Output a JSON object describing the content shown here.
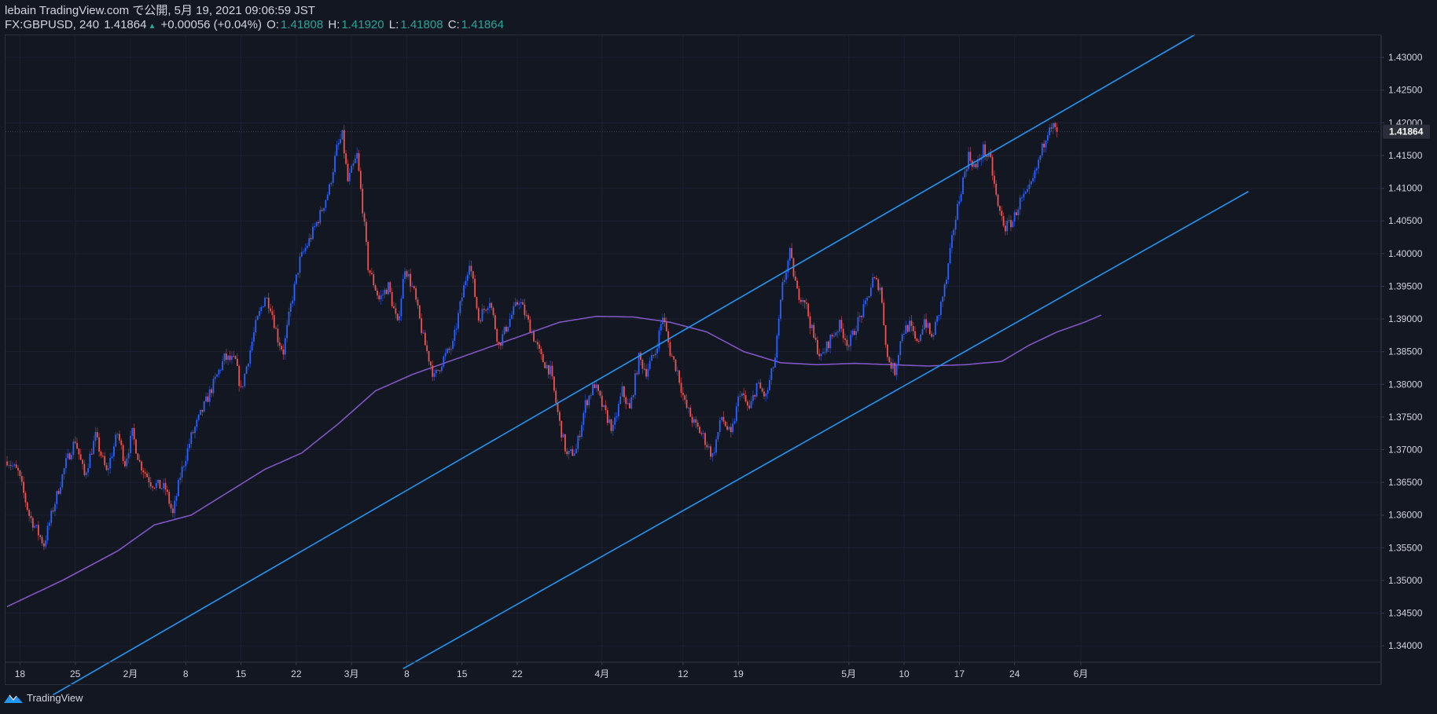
{
  "header": {
    "publish_line": "lebain TradingView.com で公開, 5月 19, 2021 09:06:59 JST",
    "symbol_interval": "FX:GBPUSD, 240",
    "last": "1.41864",
    "change": "+0.00056 (+0.04%)",
    "o_label": "O:",
    "o_value": "1.41808",
    "h_label": "H:",
    "h_value": "1.41920",
    "l_label": "L:",
    "l_value": "1.41808",
    "c_label": "C:",
    "c_value": "1.41864"
  },
  "footer": {
    "brand": "TradingView",
    "logo_icon": "tradingview-logo-icon"
  },
  "colors": {
    "background": "#131722",
    "up_candle": "#2962ff",
    "down_candle": "#ef5350",
    "moving_average": "#7e57c2",
    "channel": "#2196f3",
    "text": "#d1d4dc",
    "positive": "#26a69a"
  },
  "chart_data": {
    "type": "candlestick",
    "symbol": "FX:GBPUSD",
    "interval": "240",
    "y_ticks": [
      "1.43000",
      "1.42500",
      "1.42000",
      "1.41500",
      "1.41000",
      "1.40500",
      "1.40000",
      "1.39500",
      "1.39000",
      "1.38500",
      "1.38000",
      "1.37500",
      "1.37000",
      "1.36500",
      "1.36000",
      "1.35500",
      "1.35000",
      "1.34500",
      "1.34000"
    ],
    "ylim": [
      1.3375,
      1.4335
    ],
    "last_price_label": "1.41864",
    "x_ticks": [
      {
        "label": "18",
        "idx": 7
      },
      {
        "label": "25",
        "idx": 37
      },
      {
        "label": "2月",
        "idx": 67
      },
      {
        "label": "8",
        "idx": 97
      },
      {
        "label": "15",
        "idx": 127
      },
      {
        "label": "22",
        "idx": 157
      },
      {
        "label": "3月",
        "idx": 187
      },
      {
        "label": "8",
        "idx": 217
      },
      {
        "label": "15",
        "idx": 247
      },
      {
        "label": "22",
        "idx": 277
      },
      {
        "label": "4月",
        "idx": 323
      },
      {
        "label": "12",
        "idx": 367
      },
      {
        "label": "19",
        "idx": 397
      },
      {
        "label": "5月",
        "idx": 457
      },
      {
        "label": "10",
        "idx": 487
      },
      {
        "label": "17",
        "idx": 517
      },
      {
        "label": "24",
        "idx": 547
      },
      {
        "label": "6月",
        "idx": 583
      }
    ],
    "close_keypoints": [
      [
        0,
        1.3685
      ],
      [
        6,
        1.3665
      ],
      [
        12,
        1.36
      ],
      [
        20,
        1.3555
      ],
      [
        25,
        1.361
      ],
      [
        32,
        1.368
      ],
      [
        37,
        1.3715
      ],
      [
        42,
        1.366
      ],
      [
        48,
        1.372
      ],
      [
        54,
        1.3665
      ],
      [
        60,
        1.3725
      ],
      [
        64,
        1.368
      ],
      [
        68,
        1.3725
      ],
      [
        72,
        1.368
      ],
      [
        78,
        1.365
      ],
      [
        86,
        1.364
      ],
      [
        90,
        1.36
      ],
      [
        94,
        1.366
      ],
      [
        100,
        1.372
      ],
      [
        106,
        1.376
      ],
      [
        112,
        1.38
      ],
      [
        118,
        1.384
      ],
      [
        124,
        1.3835
      ],
      [
        127,
        1.379
      ],
      [
        131,
        1.384
      ],
      [
        135,
        1.389
      ],
      [
        140,
        1.3935
      ],
      [
        143,
        1.392
      ],
      [
        147,
        1.387
      ],
      [
        150,
        1.385
      ],
      [
        154,
        1.392
      ],
      [
        159,
        1.399
      ],
      [
        164,
        1.402
      ],
      [
        170,
        1.406
      ],
      [
        175,
        1.41
      ],
      [
        179,
        1.416
      ],
      [
        182,
        1.418
      ],
      [
        185,
        1.411
      ],
      [
        190,
        1.415
      ],
      [
        193,
        1.407
      ],
      [
        196,
        1.398
      ],
      [
        202,
        1.393
      ],
      [
        207,
        1.395
      ],
      [
        212,
        1.389
      ],
      [
        216,
        1.398
      ],
      [
        221,
        1.394
      ],
      [
        226,
        1.387
      ],
      [
        232,
        1.381
      ],
      [
        237,
        1.384
      ],
      [
        242,
        1.386
      ],
      [
        246,
        1.392
      ],
      [
        251,
        1.399
      ],
      [
        256,
        1.39
      ],
      [
        262,
        1.393
      ],
      [
        267,
        1.386
      ],
      [
        273,
        1.39
      ],
      [
        278,
        1.393
      ],
      [
        285,
        1.388
      ],
      [
        290,
        1.384
      ],
      [
        295,
        1.382
      ],
      [
        300,
        1.374
      ],
      [
        304,
        1.369
      ],
      [
        309,
        1.37
      ],
      [
        314,
        1.377
      ],
      [
        319,
        1.38
      ],
      [
        324,
        1.376
      ],
      [
        329,
        1.373
      ],
      [
        334,
        1.379
      ],
      [
        338,
        1.376
      ],
      [
        343,
        1.384
      ],
      [
        347,
        1.382
      ],
      [
        352,
        1.385
      ],
      [
        356,
        1.3905
      ],
      [
        360,
        1.385
      ],
      [
        364,
        1.382
      ],
      [
        368,
        1.377
      ],
      [
        373,
        1.374
      ],
      [
        378,
        1.372
      ],
      [
        383,
        1.369
      ],
      [
        388,
        1.375
      ],
      [
        393,
        1.372
      ],
      [
        398,
        1.379
      ],
      [
        403,
        1.376
      ],
      [
        407,
        1.38
      ],
      [
        412,
        1.378
      ],
      [
        417,
        1.384
      ],
      [
        421,
        1.395
      ],
      [
        425,
        1.4
      ],
      [
        429,
        1.394
      ],
      [
        433,
        1.393
      ],
      [
        438,
        1.387
      ],
      [
        442,
        1.384
      ],
      [
        447,
        1.387
      ],
      [
        452,
        1.389
      ],
      [
        457,
        1.386
      ],
      [
        461,
        1.389
      ],
      [
        466,
        1.392
      ],
      [
        470,
        1.396
      ],
      [
        474,
        1.395
      ],
      [
        478,
        1.384
      ],
      [
        482,
        1.382
      ],
      [
        486,
        1.388
      ],
      [
        490,
        1.389
      ],
      [
        494,
        1.386
      ],
      [
        498,
        1.39
      ],
      [
        502,
        1.387
      ],
      [
        506,
        1.391
      ],
      [
        510,
        1.396
      ],
      [
        514,
        1.404
      ],
      [
        518,
        1.41
      ],
      [
        522,
        1.415
      ],
      [
        526,
        1.413
      ],
      [
        530,
        1.416
      ],
      [
        534,
        1.414
      ],
      [
        538,
        1.407
      ],
      [
        542,
        1.404
      ],
      [
        546,
        1.405
      ],
      [
        550,
        1.408
      ],
      [
        554,
        1.409
      ],
      [
        558,
        1.412
      ],
      [
        562,
        1.416
      ],
      [
        566,
        1.42
      ],
      [
        570,
        1.4186
      ]
    ],
    "moving_average_keypoints": [
      [
        0,
        1.346
      ],
      [
        30,
        1.35
      ],
      [
        60,
        1.3545
      ],
      [
        80,
        1.3585
      ],
      [
        100,
        1.36
      ],
      [
        120,
        1.3635
      ],
      [
        140,
        1.367
      ],
      [
        160,
        1.3695
      ],
      [
        180,
        1.374
      ],
      [
        200,
        1.379
      ],
      [
        220,
        1.3815
      ],
      [
        240,
        1.3835
      ],
      [
        260,
        1.3855
      ],
      [
        280,
        1.3875
      ],
      [
        300,
        1.3895
      ],
      [
        320,
        1.3904
      ],
      [
        340,
        1.3903
      ],
      [
        360,
        1.3895
      ],
      [
        380,
        1.388
      ],
      [
        400,
        1.385
      ],
      [
        420,
        1.3833
      ],
      [
        440,
        1.383
      ],
      [
        460,
        1.3832
      ],
      [
        480,
        1.383
      ],
      [
        500,
        1.3828
      ],
      [
        520,
        1.383
      ],
      [
        540,
        1.3835
      ],
      [
        555,
        1.386
      ],
      [
        570,
        1.388
      ],
      [
        585,
        1.3895
      ],
      [
        595,
        1.3907
      ]
    ],
    "channel_upper": [
      [
        25,
        1.3325
      ],
      [
        645,
        1.4335
      ]
    ],
    "channel_lower": [
      [
        215,
        1.3365
      ],
      [
        674,
        1.4095
      ]
    ]
  }
}
